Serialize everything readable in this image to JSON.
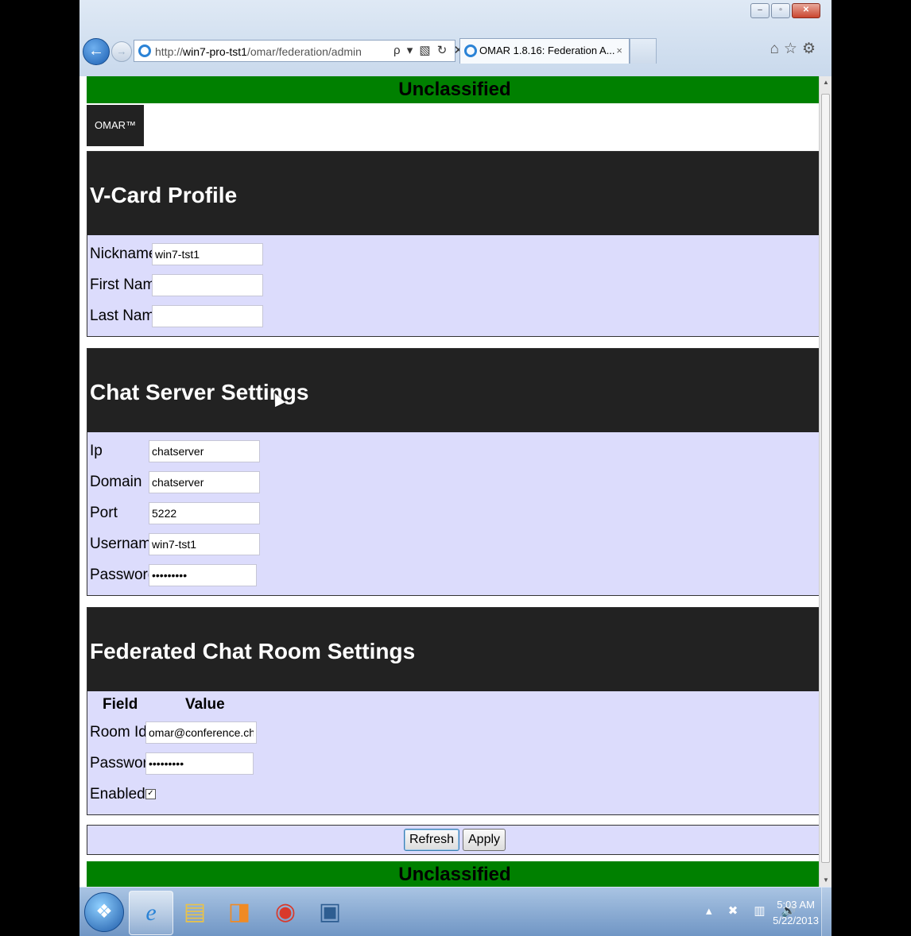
{
  "browser": {
    "address_prefix": "http://",
    "address_host": "win7-pro-tst1",
    "address_path": "/omar/federation/admin",
    "address_tools": "ρ ▾ ▧ ↻ ✕",
    "tab_title": "OMAR 1.8.16: Federation A...",
    "tab_close": "×",
    "window_buttons": {
      "minimize": "–",
      "maximize": "▫",
      "close": "✕"
    },
    "right_icons": "⌂☆⚙"
  },
  "page": {
    "classification_top": "Unclassified",
    "classification_bottom": "Unclassified",
    "brand": "OMAR™",
    "vcard": {
      "title": "V-Card Profile",
      "nickname_label": "Nickname",
      "nickname_value": "win7-tst1",
      "first_name_label": "First Name",
      "first_name_value": "",
      "last_name_label": "Last Name",
      "last_name_value": ""
    },
    "chat_server": {
      "title": "Chat Server Settings",
      "ip_label": "Ip",
      "ip_value": "chatserver",
      "domain_label": "Domain",
      "domain_value": "chatserver",
      "port_label": "Port",
      "port_value": "5222",
      "username_label": "Username",
      "username_value": "win7-tst1",
      "password_label": "Password",
      "password_value": "•••••••••"
    },
    "federated_room": {
      "title": "Federated Chat Room Settings",
      "col_field": "Field",
      "col_value": "Value",
      "room_id_label": "Room Id",
      "room_id_value": "omar@conference.chats",
      "password_label": "Password",
      "password_value": "•••••••••",
      "enabled_label": "Enabled",
      "enabled_checked": true,
      "enabled_mark": "✓"
    },
    "actions": {
      "refresh_label": "Refresh",
      "apply_label": "Apply"
    }
  },
  "taskbar": {
    "items": [
      "windows-start",
      "internet-explorer",
      "file-explorer",
      "media-player",
      "chrome",
      "window-app"
    ],
    "clock_time": "5:03 AM",
    "clock_date": "5/22/2013",
    "tray_icons": "▴ ✖ ▥ 🔊"
  },
  "colors": {
    "classification_banner": "#008000",
    "section_header": "#222222",
    "section_body": "#dcdcfc"
  }
}
